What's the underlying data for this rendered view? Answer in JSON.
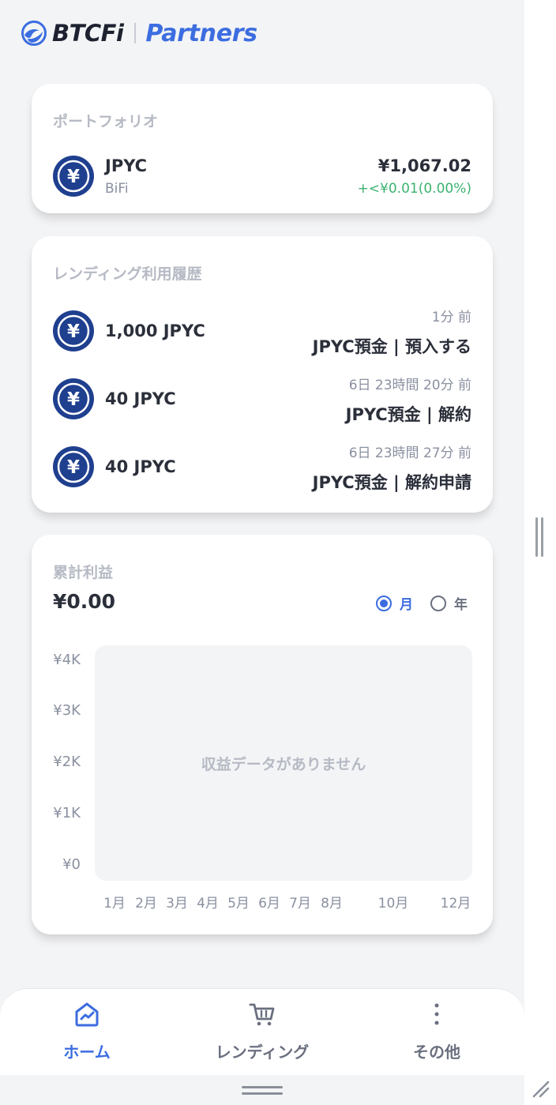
{
  "brand": {
    "name": "BTCFi",
    "sub": "Partners",
    "accent": "#3c6de0"
  },
  "portfolio": {
    "title": "ポートフォリオ",
    "asset": {
      "name": "JPYC",
      "platform": "BiFi",
      "value": "¥1,067.02",
      "change": "+<¥0.01(0.00%)",
      "icon": "yen-coin-icon"
    }
  },
  "history": {
    "title": "レンディング利用履歴",
    "rows": [
      {
        "amount": "1,000 JPYC",
        "time": "1分 前",
        "action": "JPYC預金 | 預入する"
      },
      {
        "amount": "40 JPYC",
        "time": "6日 23時間 20分 前",
        "action": "JPYC預金 | 解約"
      },
      {
        "amount": "40 JPYC",
        "time": "6日 23時間 27分 前",
        "action": "JPYC預金 | 解約申請"
      }
    ]
  },
  "profit": {
    "title": "累計利益",
    "value": "¥0.00",
    "period_options": [
      {
        "label": "月",
        "selected": true
      },
      {
        "label": "年",
        "selected": false
      }
    ],
    "empty_message": "収益データがありません"
  },
  "chart_data": {
    "type": "bar",
    "title": "",
    "xlabel": "",
    "ylabel": "",
    "yticks": [
      "¥4K",
      "¥3K",
      "¥2K",
      "¥1K",
      "¥0"
    ],
    "categories": [
      "1月",
      "2月",
      "3月",
      "4月",
      "5月",
      "6月",
      "7月",
      "8月",
      "10月",
      "12月"
    ],
    "values": [],
    "ylim": [
      0,
      4000
    ],
    "grid": false
  },
  "nav": {
    "items": [
      {
        "label": "ホーム",
        "icon": "home-chart-icon",
        "active": true
      },
      {
        "label": "レンディング",
        "icon": "cart-icon",
        "active": false
      },
      {
        "label": "その他",
        "icon": "more-vertical-icon",
        "active": false
      }
    ]
  }
}
